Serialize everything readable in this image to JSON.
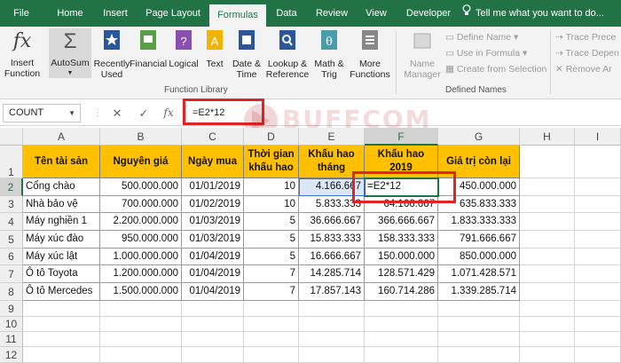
{
  "tabs": [
    "File",
    "Home",
    "Insert",
    "Page Layout",
    "Formulas",
    "Data",
    "Review",
    "View",
    "Developer"
  ],
  "tell_me": "Tell me what you want to do...",
  "ribbon": {
    "insert_function": "Insert Function",
    "autosum": "AutoSum",
    "recently_used": "Recently Used",
    "financial": "Financial",
    "logical": "Logical",
    "text": "Text",
    "date_time": "Date & Time",
    "lookup_reference": "Lookup & Reference",
    "math_trig": "Math & Trig",
    "more_functions": "More Functions",
    "name_manager": "Name Manager",
    "define_name": "Define Name",
    "use_in_formula": "Use in Formula",
    "create_from_selection": "Create from Selection",
    "trace_precedents": "Trace Prece",
    "trace_dependents": "Trace Depen",
    "remove_arrows": "Remove Ar",
    "group_function_library": "Function Library",
    "group_defined_names": "Defined Names"
  },
  "formula_bar": {
    "name_box": "COUNT",
    "formula": "=E2*12"
  },
  "watermark": "BUFFCOM",
  "columns": [
    "A",
    "B",
    "C",
    "D",
    "E",
    "F",
    "G",
    "H",
    "I"
  ],
  "rows": [
    "1",
    "2",
    "3",
    "4",
    "5",
    "6",
    "7",
    "8",
    "9",
    "10",
    "11",
    "12"
  ],
  "table": {
    "headers": [
      "Tên tài sản",
      "Nguyên giá",
      "Ngày mua",
      "Thời gian khấu hao",
      "Khấu hao tháng",
      "Khấu hao 2019",
      "Giá trị còn lại"
    ],
    "rows": [
      [
        "Cổng chào",
        "500.000.000",
        "01/01/2019",
        "10",
        "4.166.667",
        "=E2*12",
        "450.000.000"
      ],
      [
        "Nhà bảo vệ",
        "700.000.000",
        "01/02/2019",
        "10",
        "5.833.333",
        "64.166.667",
        "635.833.333"
      ],
      [
        "Máy nghiền 1",
        "2.200.000.000",
        "01/03/2019",
        "5",
        "36.666.667",
        "366.666.667",
        "1.833.333.333"
      ],
      [
        "Máy xúc đào",
        "950.000.000",
        "01/03/2019",
        "5",
        "15.833.333",
        "158.333.333",
        "791.666.667"
      ],
      [
        "Máy xúc lật",
        "1.000.000.000",
        "01/04/2019",
        "5",
        "16.666.667",
        "150.000.000",
        "850.000.000"
      ],
      [
        "Ô tô Toyota",
        "1.200.000.000",
        "01/04/2019",
        "7",
        "14.285.714",
        "128.571.429",
        "1.071.428.571"
      ],
      [
        "Ô tô Mercedes",
        "1.500.000.000",
        "01/04/2019",
        "7",
        "17.857.143",
        "160.714.286",
        "1.339.285.714"
      ]
    ]
  }
}
